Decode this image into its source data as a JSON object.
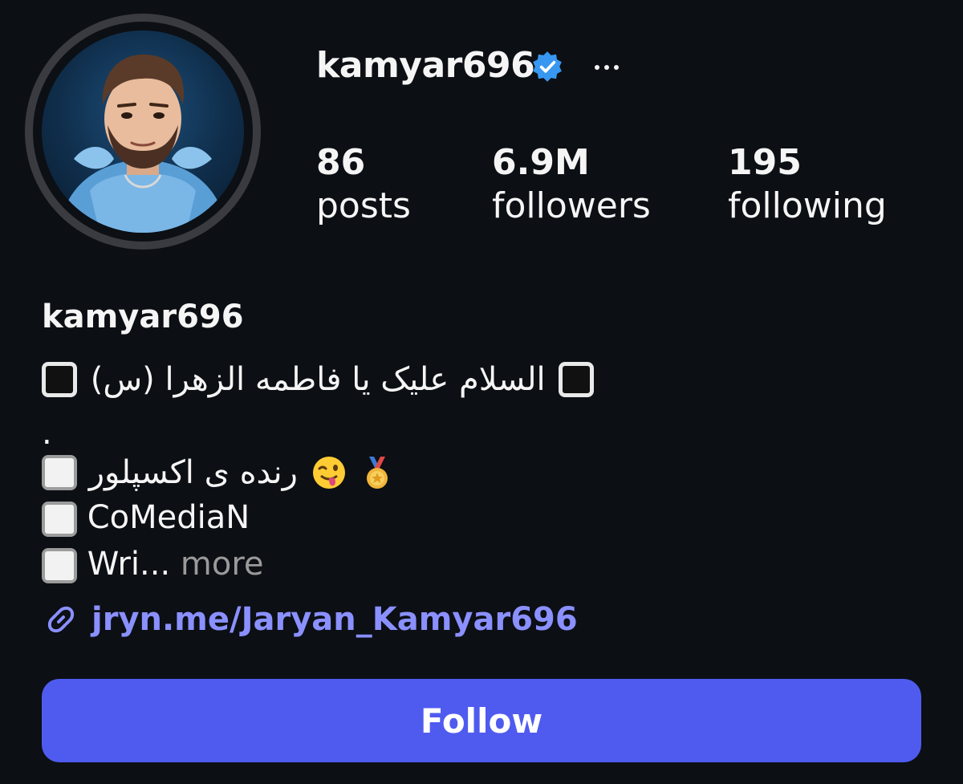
{
  "profile": {
    "username": "kamyar696",
    "verified": true,
    "more_icon": "more-horizontal-icon"
  },
  "stats": {
    "posts": {
      "value": "86",
      "label": "posts"
    },
    "followers": {
      "value": "6.9M",
      "label": "followers"
    },
    "following": {
      "value": "195",
      "label": "following"
    }
  },
  "bio": {
    "name": "kamyar696",
    "line1_text": "السلام علیک یا فاطمه الزهرا (س)",
    "line2_text": ".",
    "line3_text": "رنده ی اکسپلور",
    "line4_text": "CoMediaN",
    "line5_text": "Wri...",
    "more_label": "more",
    "emoji_wink": "winking-face-with-tongue-emoji",
    "emoji_medal": "medal-emoji"
  },
  "link": {
    "text": "jryn.me/Jaryan_Kamyar696",
    "icon": "link-icon",
    "color": "#8a90ff"
  },
  "follow_button": {
    "label": "Follow",
    "color": "#4f5bef"
  }
}
